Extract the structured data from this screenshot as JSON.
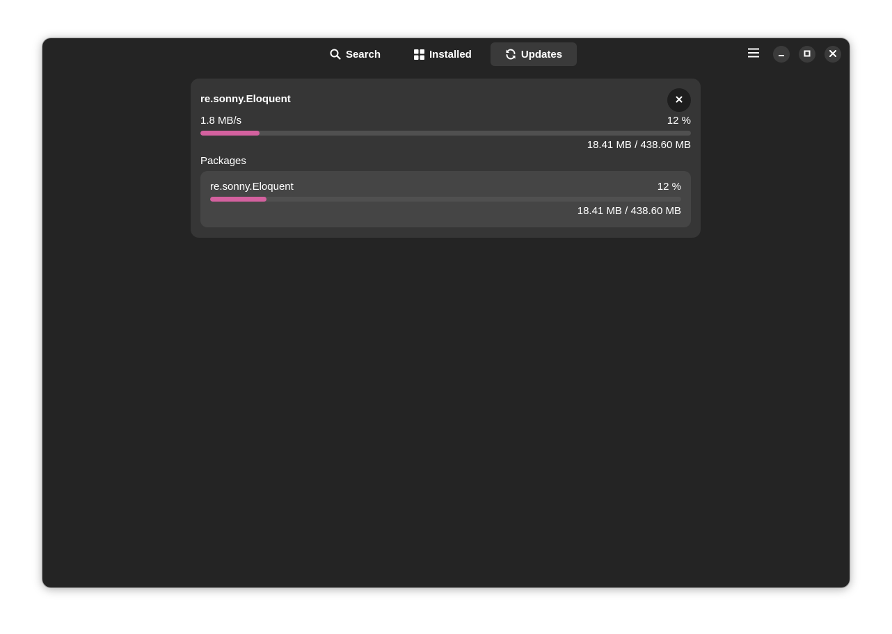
{
  "tabs": [
    {
      "label": "Search",
      "icon": "search-icon",
      "active": false
    },
    {
      "label": "Installed",
      "icon": "grid-icon",
      "active": false
    },
    {
      "label": "Updates",
      "icon": "refresh-icon",
      "active": true
    }
  ],
  "download": {
    "title": "re.sonny.Eloquent",
    "speed": "1.8 MB/s",
    "percent_text": "12 %",
    "progress": 0.12,
    "size": "18.41 MB / 438.60 MB",
    "packages_label": "Packages",
    "packages": [
      {
        "name": "re.sonny.Eloquent",
        "percent_text": "12 %",
        "progress": 0.12,
        "size": "18.41 MB / 438.60 MB"
      }
    ]
  },
  "colors": {
    "accent": "#d4619f",
    "window_bg": "#242424",
    "card_bg": "#363636"
  }
}
